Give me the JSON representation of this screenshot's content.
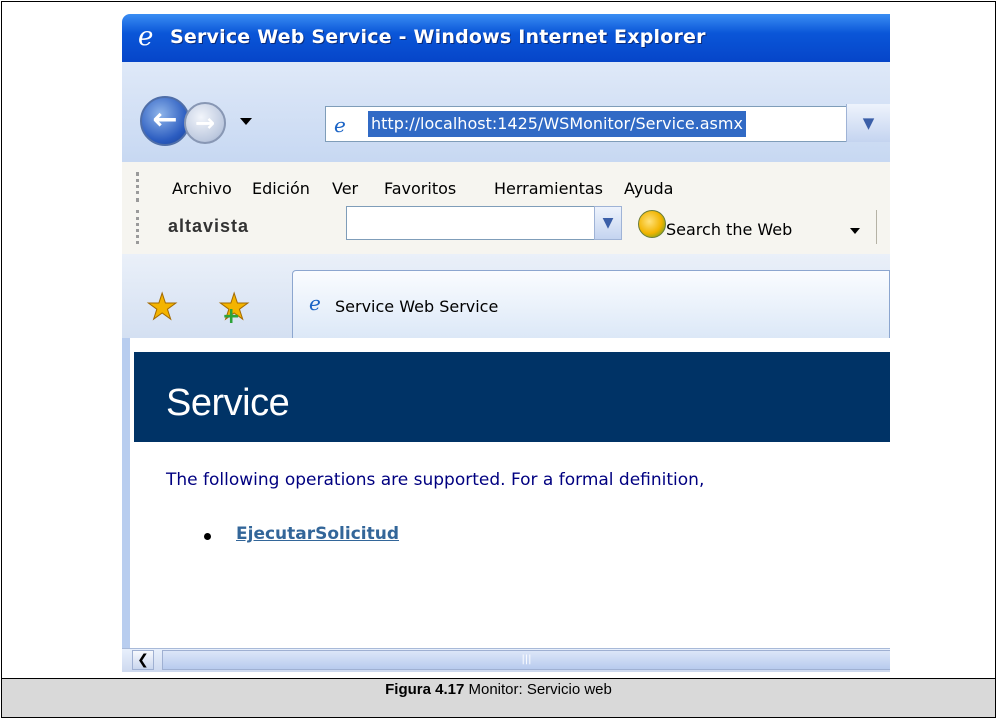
{
  "window": {
    "title": "Service Web Service - Windows Internet Explorer"
  },
  "address_bar": {
    "url": "http://localhost:1425/WSMonitor/Service.asmx"
  },
  "menu": {
    "items": [
      "Archivo",
      "Edición",
      "Ver",
      "Favoritos",
      "Herramientas",
      "Ayuda"
    ]
  },
  "altavista_toolbar": {
    "brand": "altavista",
    "search_value": "",
    "search_button_label": "Search the Web"
  },
  "tab": {
    "label": "Service Web Service"
  },
  "page": {
    "heading": "Service",
    "intro": "The following operations are supported. For a formal definition,",
    "operations": [
      "EjecutarSolicitud"
    ]
  },
  "caption": {
    "label": "Figura 4.17",
    "text": " Monitor: Servicio web"
  }
}
